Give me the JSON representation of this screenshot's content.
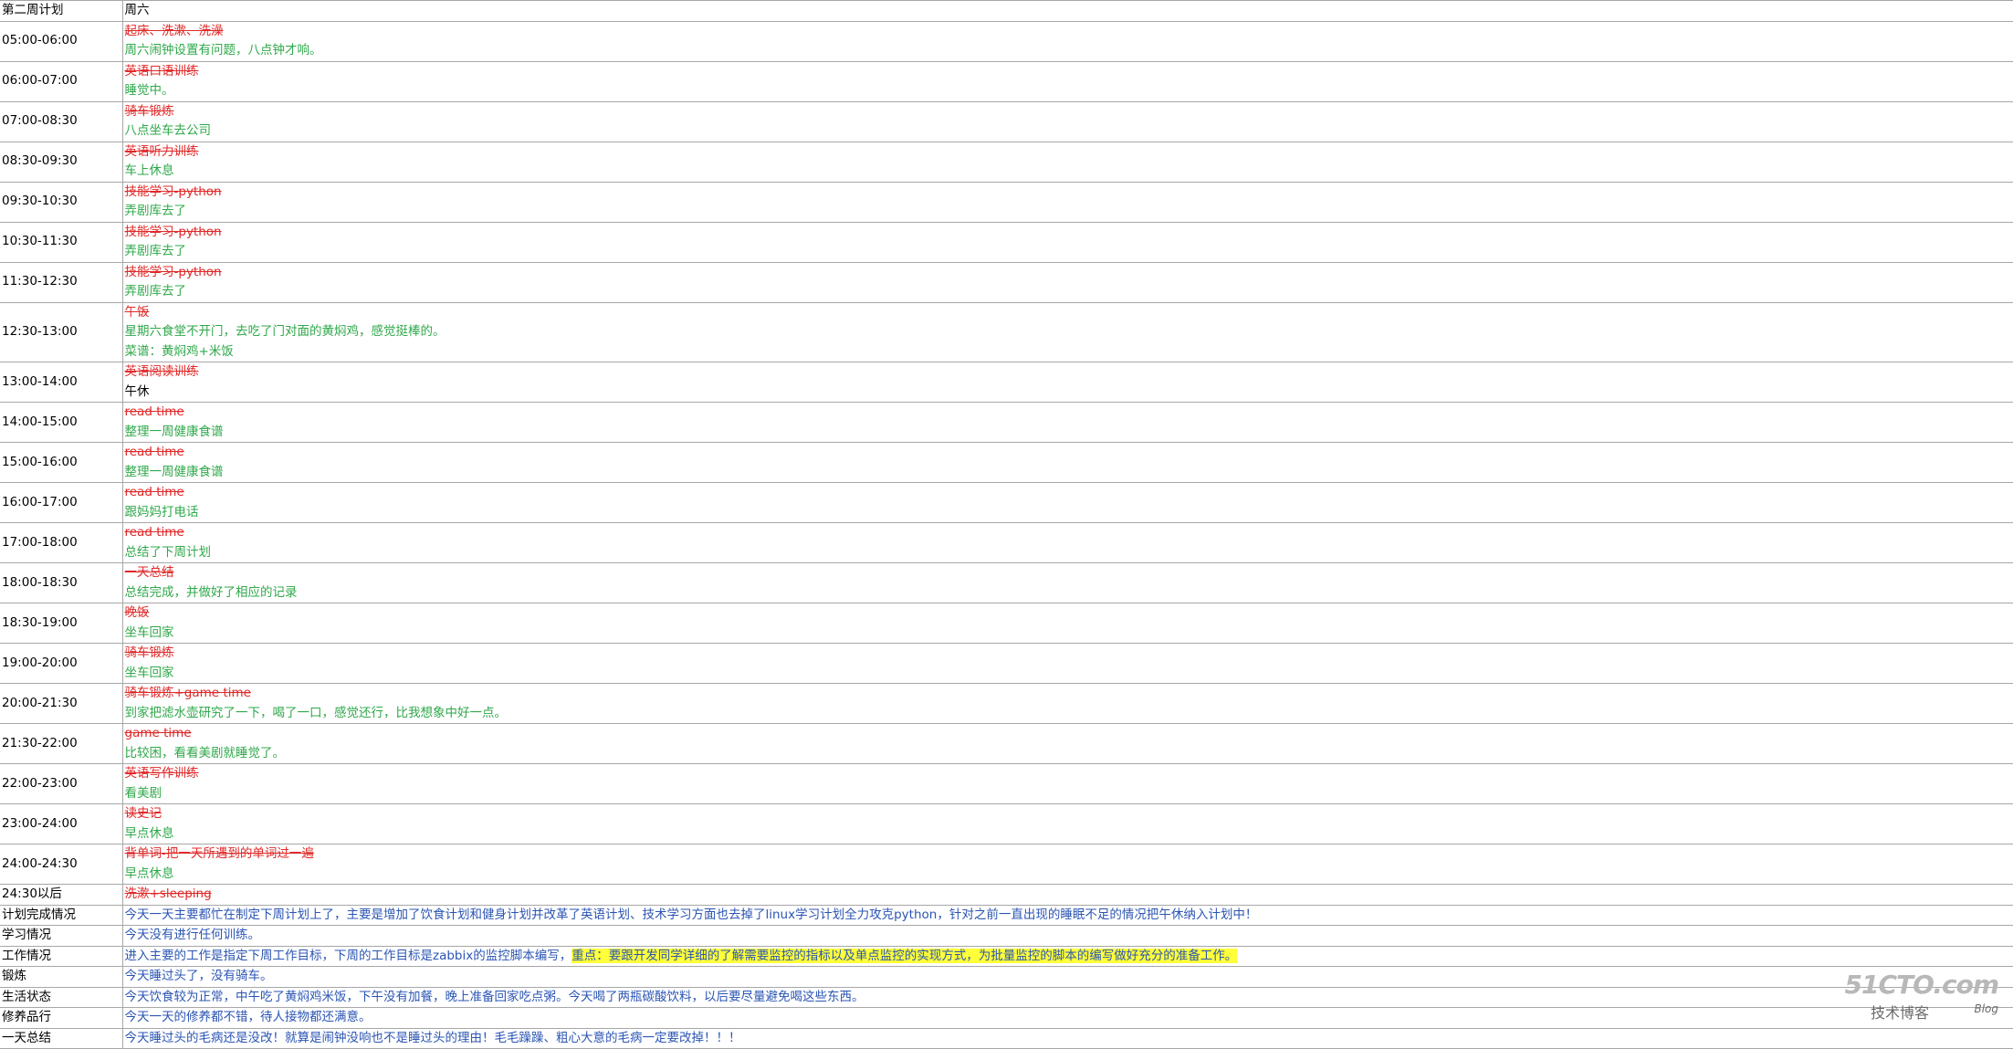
{
  "header": {
    "col1": "第二周计划",
    "col2": "周六"
  },
  "rows": [
    {
      "time": "05:00-06:00",
      "plan": "起床、洗漱、洗澡",
      "actual": [
        "周六闹钟设置有问题，八点钟才响。"
      ]
    },
    {
      "time": "06:00-07:00",
      "plan": "英语口语训练",
      "actual": [
        "睡觉中。"
      ]
    },
    {
      "time": "07:00-08:30",
      "plan": "骑车锻炼",
      "actual": [
        "八点坐车去公司"
      ]
    },
    {
      "time": "08:30-09:30",
      "plan": "英语听力训练",
      "actual": [
        "车上休息"
      ]
    },
    {
      "time": "09:30-10:30",
      "plan": "技能学习-python",
      "actual": [
        "弄剧库去了"
      ]
    },
    {
      "time": "10:30-11:30",
      "plan": "技能学习-python",
      "actual": [
        "弄剧库去了"
      ]
    },
    {
      "time": "11:30-12:30",
      "plan": "技能学习-python",
      "actual": [
        "弄剧库去了"
      ]
    },
    {
      "time": "12:30-13:00",
      "plan": "午饭",
      "actual": [
        "星期六食堂不开门，去吃了门对面的黄焖鸡，感觉挺棒的。",
        "菜谱：黄焖鸡+米饭"
      ]
    },
    {
      "time": "13:00-14:00",
      "plan": "英语阅读训练",
      "actual_black": "午休"
    },
    {
      "time": "14:00-15:00",
      "plan": "read time",
      "actual": [
        "整理一周健康食谱"
      ]
    },
    {
      "time": "15:00-16:00",
      "plan": "read time",
      "actual": [
        "整理一周健康食谱"
      ]
    },
    {
      "time": "16:00-17:00",
      "plan": "read time",
      "actual": [
        "跟妈妈打电话"
      ]
    },
    {
      "time": "17:00-18:00",
      "plan": "read time",
      "actual": [
        "总结了下周计划"
      ]
    },
    {
      "time": "18:00-18:30",
      "plan": "一天总结",
      "actual": [
        "总结完成，并做好了相应的记录"
      ]
    },
    {
      "time": "18:30-19:00",
      "plan": "晚饭",
      "actual": [
        "坐车回家"
      ]
    },
    {
      "time": "19:00-20:00",
      "plan": "骑车锻炼",
      "actual": [
        "坐车回家"
      ]
    },
    {
      "time": "20:00-21:30",
      "plan": "骑车锻炼+game time",
      "actual": [
        "到家把滤水壶研究了一下，喝了一口，感觉还行，比我想象中好一点。"
      ]
    },
    {
      "time": "21:30-22:00",
      "plan": "game time",
      "actual": [
        "比较困，看看美剧就睡觉了。"
      ]
    },
    {
      "time": "22:00-23:00",
      "plan": "英语写作训练",
      "actual": [
        "看美剧"
      ]
    },
    {
      "time": "23:00-24:00",
      "plan": "读史记",
      "actual": [
        "早点休息"
      ]
    },
    {
      "time": "24:00-24:30",
      "plan": "背单词-把一天所遇到的单词过一遍",
      "actual": [
        "早点休息"
      ]
    },
    {
      "time": "24:30以后",
      "plan": "洗漱+sleeping",
      "actual": []
    }
  ],
  "summary": [
    {
      "label": "计划完成情况",
      "text": "今天一天主要都忙在制定下周计划上了，主要是增加了饮食计划和健身计划并改革了英语计划、技术学习方面也去掉了linux学习计划全力攻克python，针对之前一直出现的睡眠不足的情况把午休纳入计划中！"
    },
    {
      "label": "学习情况",
      "text": "今天没有进行任何训练。"
    },
    {
      "label": "工作情况",
      "text": "进入主要的工作是指定下周工作目标，下周的工作目标是zabbix的监控脚本编写，",
      "highlight": "重点：要跟开发同学详细的了解需要监控的指标以及单点监控的实现方式，为批量监控的脚本的编写做好充分的准备工作。"
    },
    {
      "label": "锻炼",
      "text": "今天睡过头了，没有骑车。"
    },
    {
      "label": "生活状态",
      "text": "今天饮食较为正常，中午吃了黄焖鸡米饭，下午没有加餐，晚上准备回家吃点粥。今天喝了两瓶碳酸饮料，以后要尽量避免喝这些东西。"
    },
    {
      "label": "修养品行",
      "text": "今天一天的修养都不错，待人接物都还满意。"
    },
    {
      "label": "一天总结",
      "text": "今天睡过头的毛病还是没改！就算是闹钟没响也不是睡过头的理由！毛毛躁躁、粗心大意的毛病一定要改掉！！！"
    }
  ],
  "watermark": {
    "logo": "51CTO.com",
    "sub": "技术博客",
    "blog": "Blog"
  },
  "colors": {
    "plan": "#e02828",
    "actual": "#2fa84a",
    "summary": "#2b55b3",
    "highlight": "#ffff3a",
    "grid": "#a7a7a7"
  }
}
